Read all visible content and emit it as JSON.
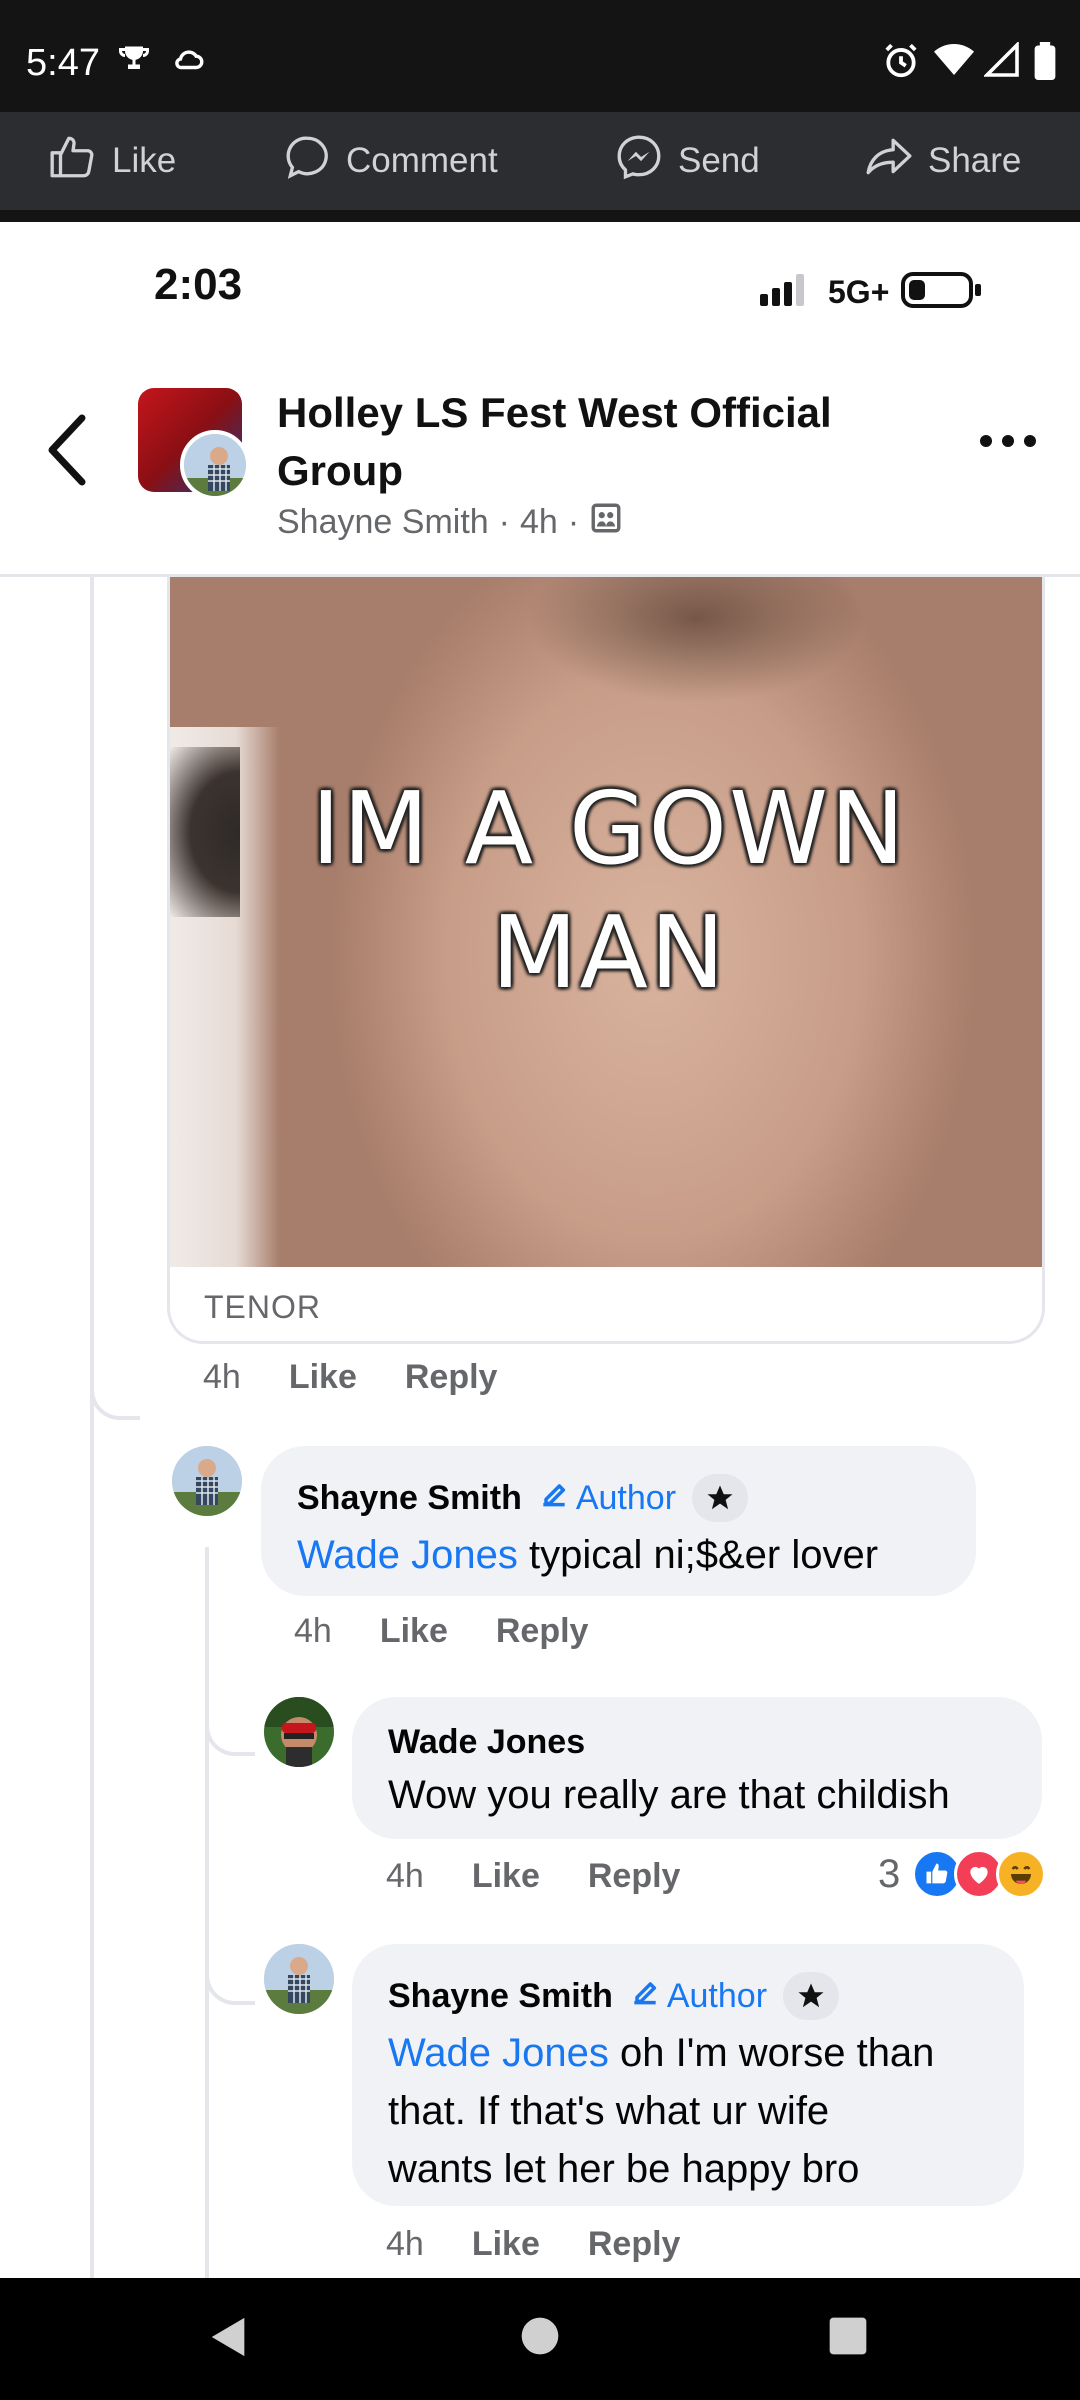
{
  "android_status": {
    "time": "5:47",
    "left_icons": [
      "trophy-icon",
      "cloud-icon"
    ],
    "right_icons": [
      "alarm-icon",
      "wifi-icon",
      "signal-icon",
      "battery-icon"
    ]
  },
  "action_bar": {
    "like": "Like",
    "comment": "Comment",
    "send": "Send",
    "share": "Share"
  },
  "ios_status": {
    "time": "2:03",
    "network": "5G+"
  },
  "header": {
    "group_title": "Holley LS Fest West Official Group",
    "poster": "Shayne Smith",
    "age": "4h",
    "separator": "·"
  },
  "gif": {
    "caption_line1": "IM A GOWN",
    "caption_line2": "MAN",
    "source": "TENOR"
  },
  "gif_meta": {
    "age": "4h",
    "like": "Like",
    "reply": "Reply"
  },
  "comments": [
    {
      "name": "Shayne Smith",
      "author_label": "Author",
      "mention": "Wade Jones",
      "text": " typical ni;$&er lover",
      "age": "4h",
      "like": "Like",
      "reply": "Reply"
    },
    {
      "name": "Wade Jones",
      "text": "Wow you really are that childish",
      "age": "4h",
      "like": "Like",
      "reply": "Reply",
      "reaction_count": "3",
      "reaction_colors": {
        "like": "#1877f2",
        "love": "#f33e58",
        "haha": "#f7b125"
      }
    },
    {
      "name": "Shayne Smith",
      "author_label": "Author",
      "mention": "Wade Jones",
      "text_line1": " oh I'm worse than",
      "text_line2": "that. If that's what ur wife",
      "text_line3": "wants let her be happy bro",
      "age": "4h",
      "like": "Like",
      "reply": "Reply"
    }
  ]
}
